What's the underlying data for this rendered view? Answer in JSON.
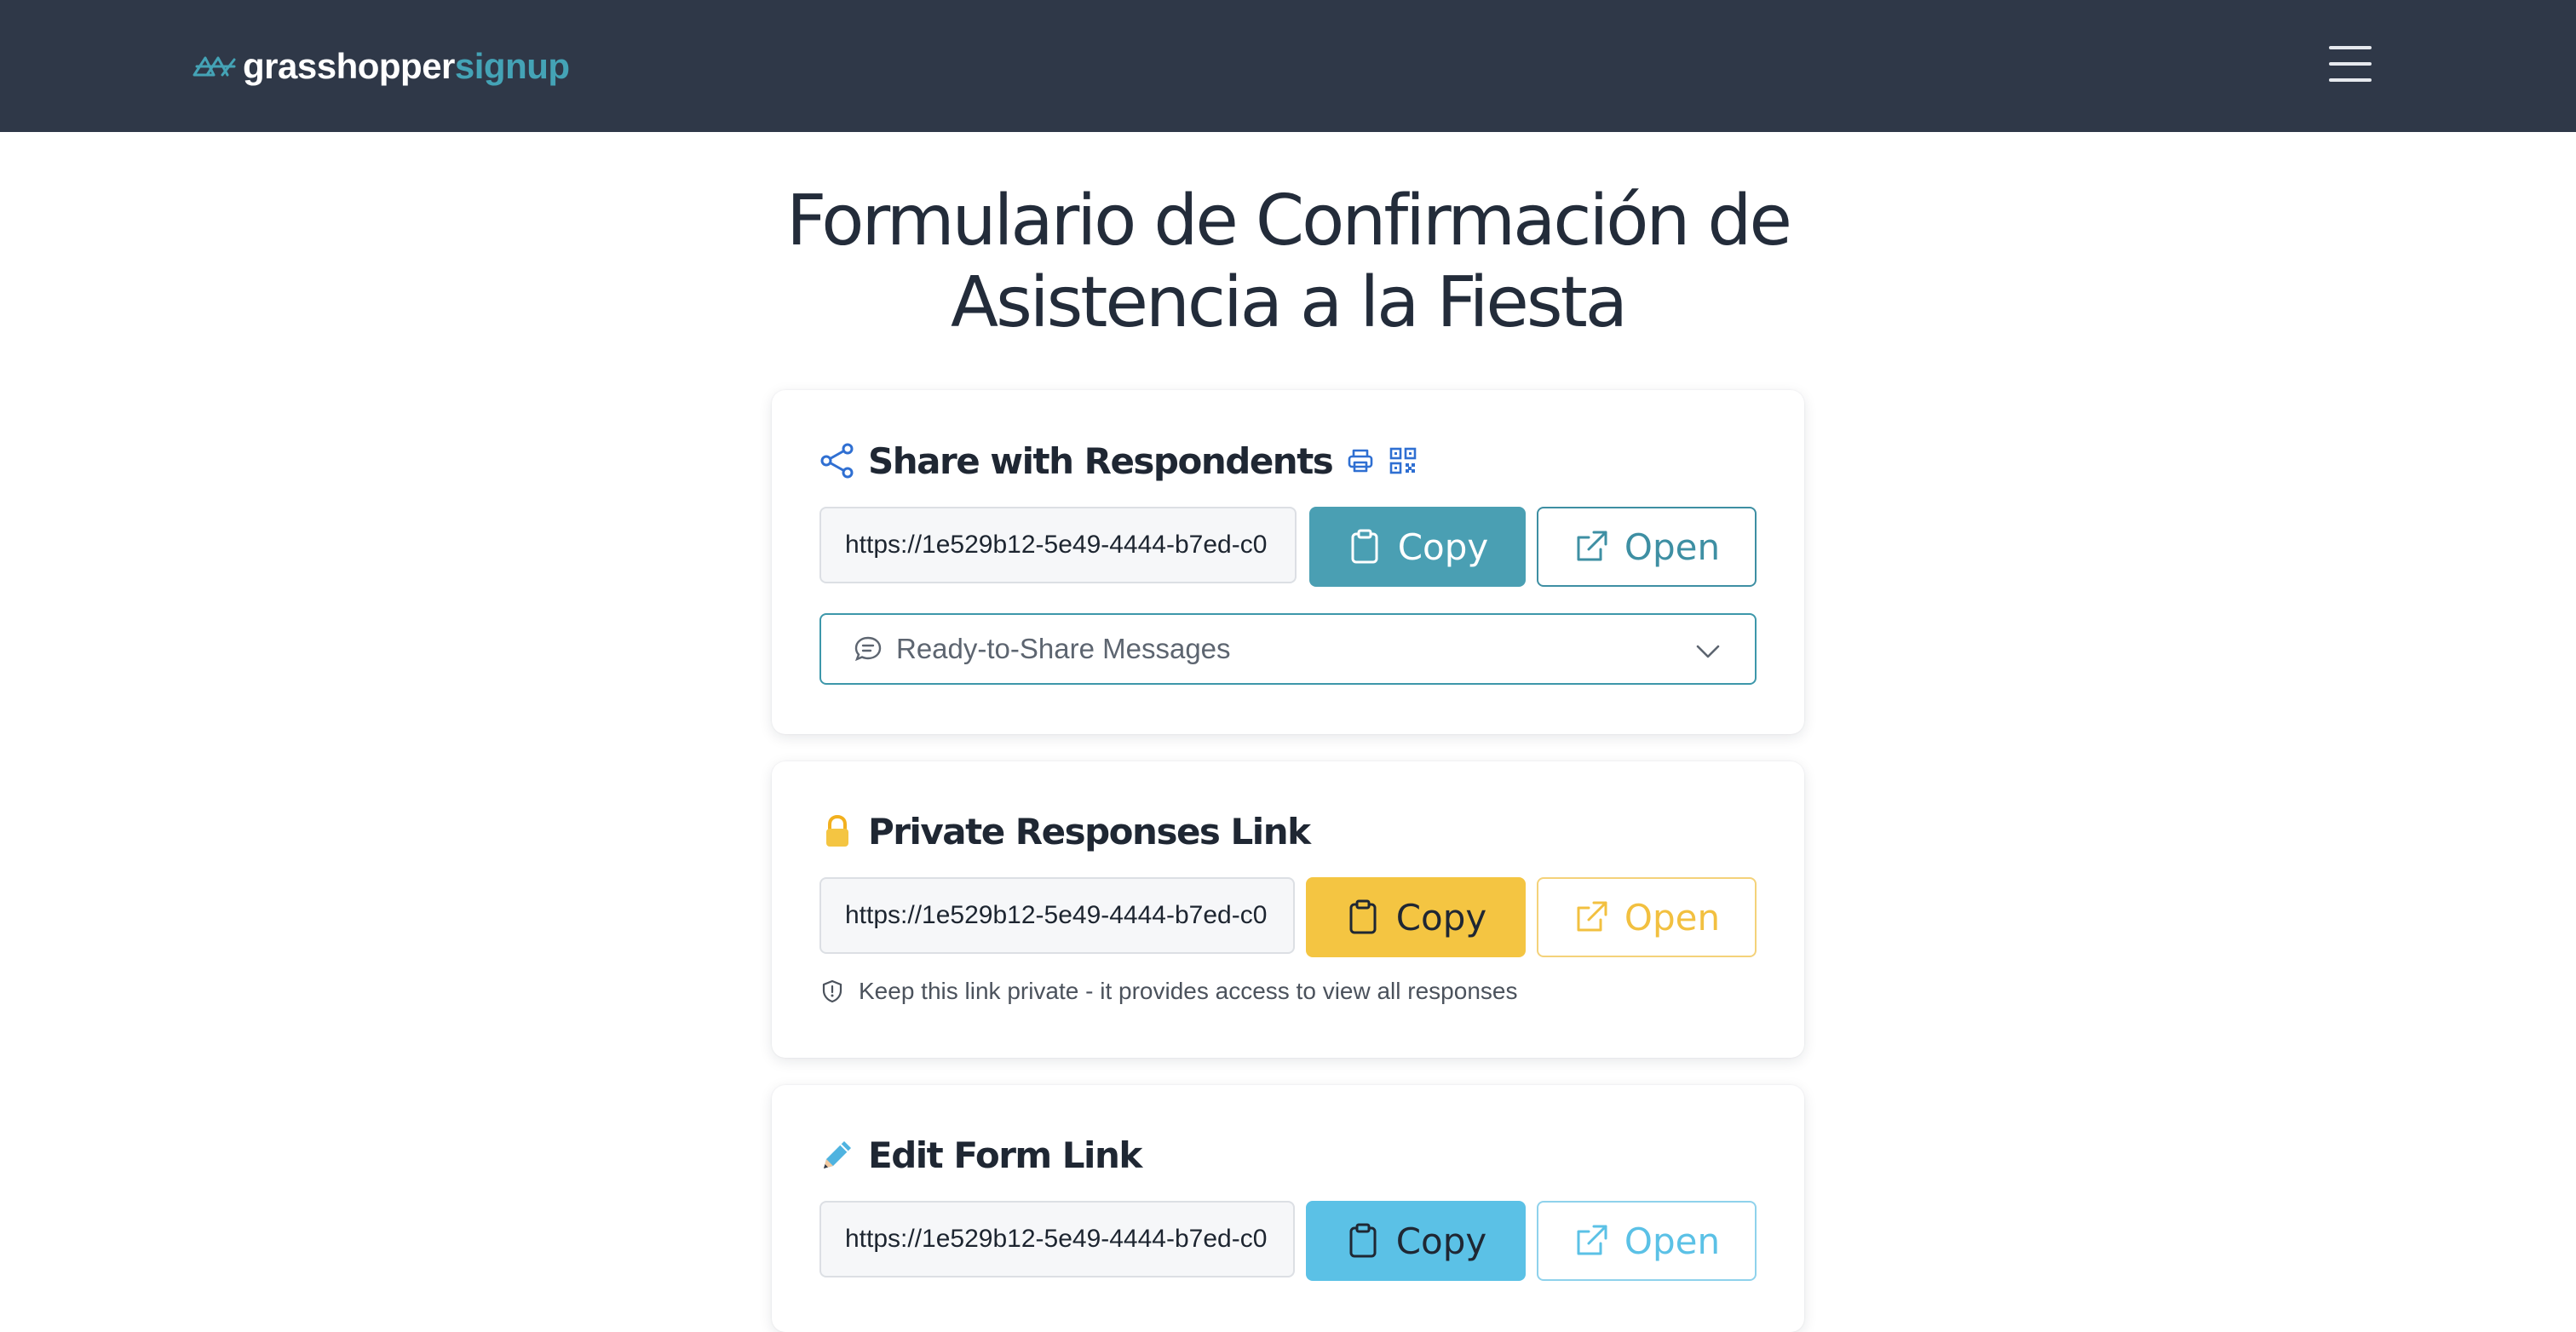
{
  "header": {
    "logo_part1": "grasshopper",
    "logo_part2": "signup",
    "menu_icon": "hamburger-menu-icon"
  },
  "page": {
    "title": "Formulario de Confirmación de Asistencia a la Fiesta"
  },
  "share_card": {
    "title": "Share with Respondents",
    "icons": [
      "share-icon",
      "print-icon",
      "qr-code-icon"
    ],
    "url": "https://1e529b12-5e49-4444-b7ed-c0",
    "copy_label": "Copy",
    "open_label": "Open",
    "messages_label": "Ready-to-Share Messages",
    "accent": "#4a9fb3"
  },
  "private_card": {
    "title": "Private Responses Link",
    "icon": "lock-icon",
    "url": "https://1e529b12-5e49-4444-b7ed-c0",
    "copy_label": "Copy",
    "open_label": "Open",
    "note": "Keep this link private - it provides access to view all responses",
    "accent": "#f4c542"
  },
  "edit_card": {
    "title": "Edit Form Link",
    "icon": "pencil-icon",
    "url": "https://1e529b12-5e49-4444-b7ed-c0",
    "copy_label": "Copy",
    "open_label": "Open",
    "accent": "#5bc1e6"
  }
}
